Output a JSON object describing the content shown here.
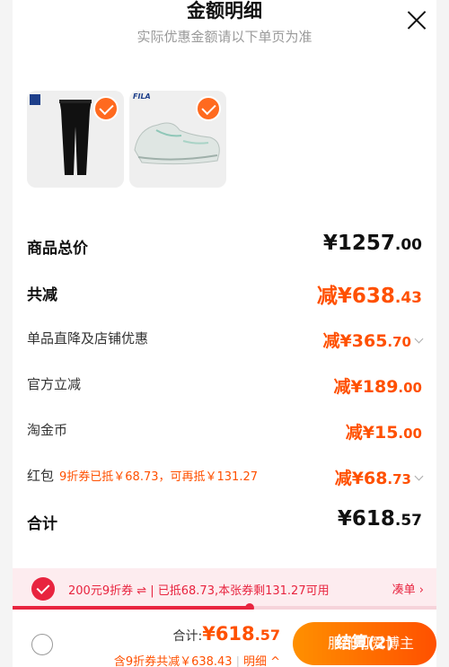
{
  "header": {
    "title": "金额明细",
    "subtitle": "实际优惠金额请以下单页为准"
  },
  "products": [
    {
      "brand": "FILA",
      "kind": "pants"
    },
    {
      "brand": "FILA",
      "kind": "sneaker"
    }
  ],
  "rows": {
    "total_goods": {
      "label": "商品总价",
      "int": "¥1257",
      "dec": ".00"
    },
    "total_discount": {
      "label": "共减",
      "int": "减¥638",
      "dec": ".43"
    },
    "shop_discount": {
      "label": "单品直降及店铺优惠",
      "int": "减¥365",
      "dec": ".70"
    },
    "official": {
      "label": "官方立减",
      "int": "减¥189",
      "dec": ".00"
    },
    "taojinbi": {
      "label": "淘金币",
      "int": "减¥15",
      "dec": ".00"
    },
    "red_packet": {
      "label": "红包",
      "note": "9折券已抵￥68.73，可再抵￥131.27",
      "int": "减¥68",
      "dec": ".73"
    },
    "sum": {
      "label": "合计",
      "int": "¥618",
      "dec": ".57"
    }
  },
  "coupon": {
    "text": "200元9折券 ⇌ | 已抵68.73,本张券剩131.27可用",
    "link": "凑单 ›",
    "progress": 0.56
  },
  "footer": {
    "total_label": "合计:",
    "total_int": "¥618",
    "total_dec": ".57",
    "coupon_note": "含9折券共减￥638.43",
    "detail_link": "明细 ^",
    "checkout_label": "结算(2)"
  },
  "watermark": "服饰可爱博主",
  "colors": {
    "accent": "#ff5000",
    "coupon_red": "#e8243f"
  }
}
